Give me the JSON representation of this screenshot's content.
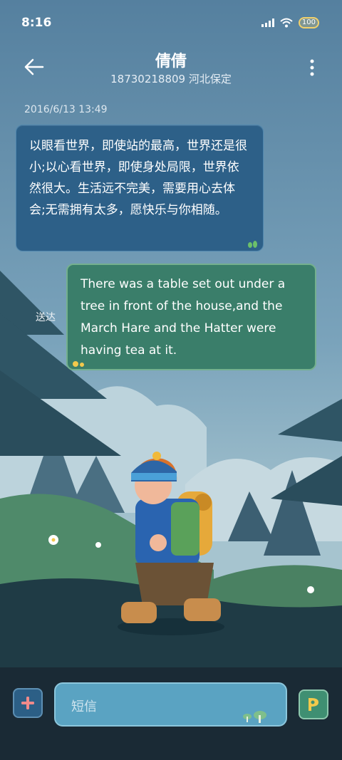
{
  "status_bar": {
    "time": "8:16",
    "battery": "100"
  },
  "header": {
    "name": "倩倩",
    "subtitle": "18730218809 河北保定"
  },
  "conversation": {
    "timestamp": "2016/6/13 13:49",
    "incoming_message": "以眼看世界，即使站的最高，世界还是很小;以心看世界，即使身处局限，世界依然很大。生活远不完美，需要用心去体会;无需拥有太多，愿快乐与你相随。",
    "outgoing_message": "There was a table set out under a tree in front of the house,and the March Hare and the Hatter were having tea at it.",
    "outgoing_status": "送达"
  },
  "composer": {
    "placeholder": "短信"
  },
  "colors": {
    "incoming_bubble": "#2d6088",
    "outgoing_bubble": "#3a7e6a",
    "input": "#5aa3c2",
    "bottom_bar": "#1a2a35"
  },
  "icons": [
    "back-arrow-icon",
    "more-vertical-icon",
    "plus-icon",
    "send-icon",
    "wifi-icon",
    "signal-icon",
    "battery-icon"
  ]
}
